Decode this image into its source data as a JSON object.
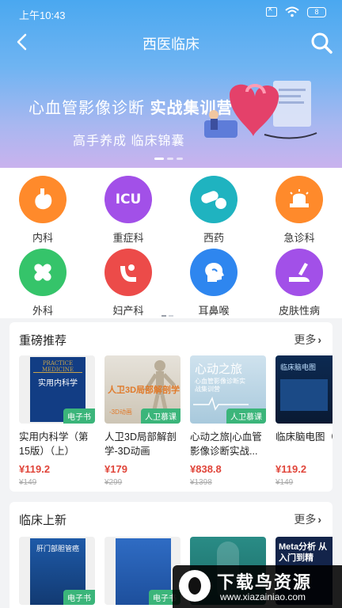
{
  "status_bar": {
    "time": "上午10:43",
    "battery": "8"
  },
  "nav": {
    "title": "西医临床"
  },
  "banner": {
    "title_plain": "心血管影像诊断",
    "title_bold": "实战集训营",
    "subtitle": "高手养成  临床锦囊"
  },
  "categories": [
    {
      "label": "内科",
      "color": "#ff8a2b"
    },
    {
      "label": "重症科",
      "color": "#a250e8"
    },
    {
      "label": "西药",
      "color": "#1fb3c0"
    },
    {
      "label": "急诊科",
      "color": "#ff8a2b"
    },
    {
      "label": "外科",
      "color": "#35c46a"
    },
    {
      "label": "妇产科",
      "color": "#ec4b49"
    },
    {
      "label": "耳鼻喉",
      "color": "#2e86ef"
    },
    {
      "label": "皮肤性病",
      "color": "#a250e8"
    }
  ],
  "featured": {
    "title": "重磅推荐",
    "more": "更多",
    "items": [
      {
        "title": "实用内科学（第15版）（上）",
        "tag": "电子书",
        "price": "¥119.2",
        "old_price": "¥149",
        "cover_text": "实用内科学"
      },
      {
        "title": "人卫3D局部解剖学-3D动画",
        "tag": "人卫慕课",
        "price": "¥179",
        "old_price": "¥299",
        "cover_text": "人卫3D局部解剖学",
        "cover_sub": "-3D动画"
      },
      {
        "title": "心动之旅|心血管影像诊断实战...",
        "tag": "人卫慕课",
        "price": "¥838.8",
        "old_price": "¥1398",
        "cover_text": "心动之旅",
        "cover_sub": "心血管影像诊断实战集训营"
      },
      {
        "title": "临床脑电图（富媒体电",
        "tag": "",
        "price": "¥119.2",
        "old_price": "¥149",
        "cover_text": "临床脑电图"
      }
    ]
  },
  "new_section": {
    "title": "临床上新",
    "more": "更多",
    "items": [
      {
        "tag": "电子书",
        "cover_text": "肝门部胆管癌"
      },
      {
        "tag": "电子书"
      },
      {
        "tag": ""
      },
      {
        "tag": "",
        "cover_text": "Meta分析 从入门到精"
      }
    ]
  },
  "watermark": {
    "name": "下载鸟资源",
    "url": "www.xiazainiao.com"
  }
}
